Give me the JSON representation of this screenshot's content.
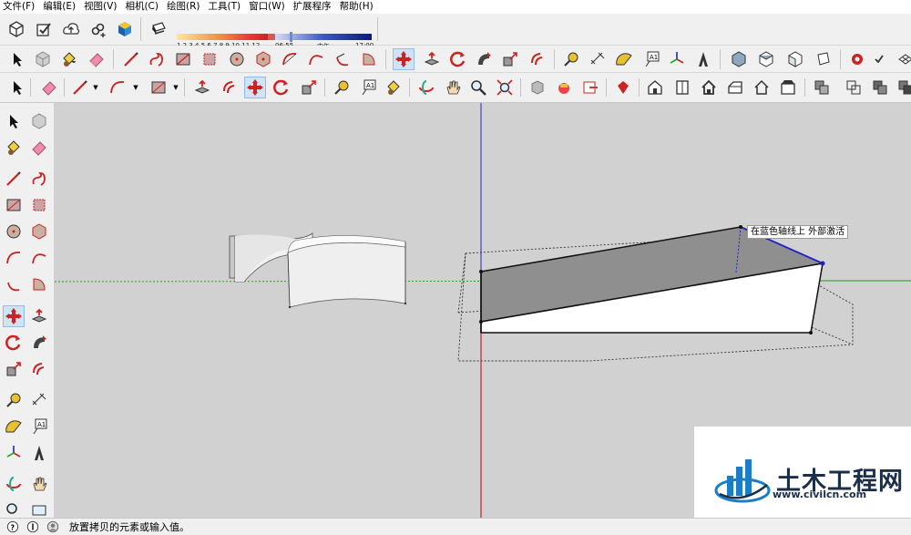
{
  "menubar": {
    "items": [
      "文件(F)",
      "编辑(E)",
      "视图(V)",
      "相机(C)",
      "绘图(R)",
      "工具(T)",
      "窗口(W)",
      "扩展程序",
      "帮助(H)"
    ]
  },
  "shadow": {
    "month_ticks": "1 2 3 4 5 6 7 8 9 10 11 12",
    "time_start": "06:55",
    "time_mid": "中午",
    "time_end": "17:00"
  },
  "viewport": {
    "tooltip": "在蓝色轴线上 外部激活"
  },
  "statusbar": {
    "message": "放置拷贝的元素或输入值。"
  },
  "watermark": {
    "title": "土木工程网",
    "url": "www.civilcn.com"
  },
  "colors": {
    "viewport_bg": "#d1d1d1",
    "axis_red": "#cc0000",
    "axis_green": "#1a9a1a",
    "axis_blue": "#2222cc",
    "active_tool": "#cfe3f7",
    "watermark_blue": "#1b2e4a"
  },
  "icons": {
    "active_tool": "move-icon"
  }
}
